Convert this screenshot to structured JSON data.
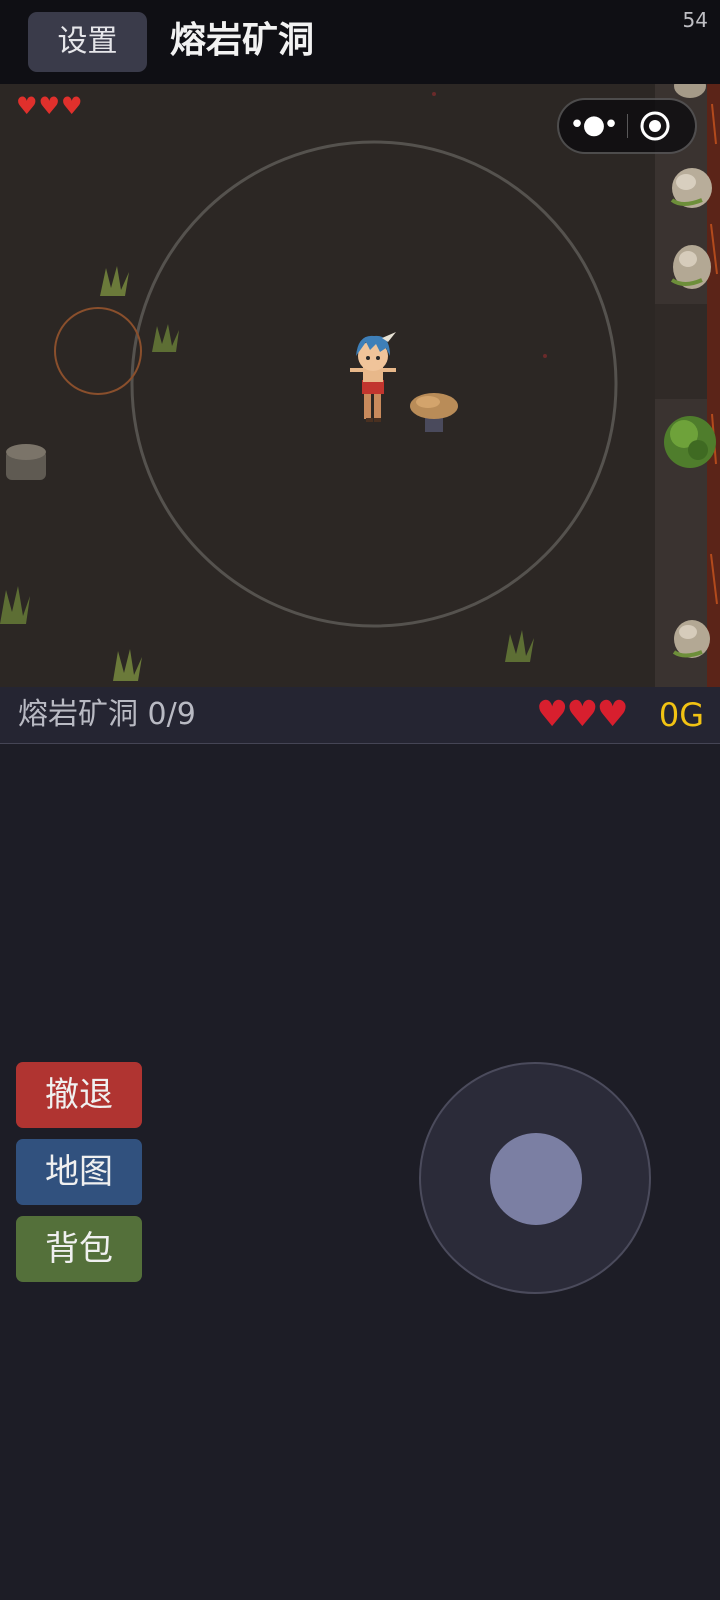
{
  "header": {
    "settings_label": "设置",
    "title": "熔岩矿洞",
    "fps": "54"
  },
  "hud": {
    "hearts": "♥♥♥"
  },
  "capsule": {
    "more_label": "•●•"
  },
  "status": {
    "zone_label": "熔岩矿洞 0/9",
    "hearts": "♥♥♥",
    "gold": "0G"
  },
  "actions": {
    "retreat_label": "撤退",
    "map_label": "地图",
    "bag_label": "背包"
  },
  "colors": {
    "topbar_bg": "#0f0f14",
    "ground": "#2c2724",
    "retreat": "#b03431",
    "map": "#31517e",
    "bag": "#54703a",
    "gold": "#f2c313",
    "heart": "#d81f2e"
  }
}
